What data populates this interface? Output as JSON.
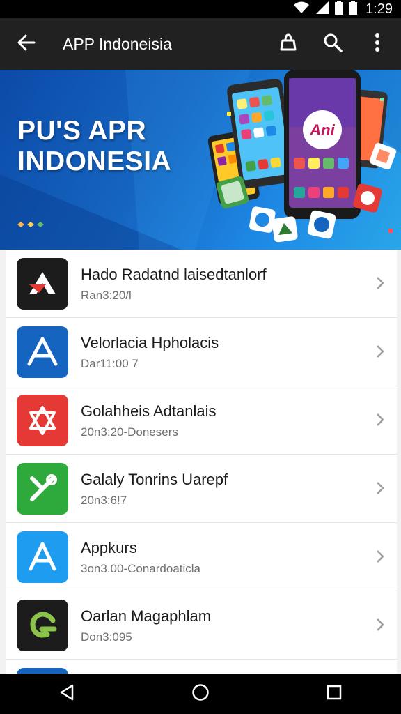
{
  "status_bar": {
    "time": "1:29",
    "icons": [
      "wifi-icon",
      "signal-icon",
      "battery-icon"
    ]
  },
  "toolbar": {
    "title": "APP Indoneisia",
    "icons": [
      "back-arrow-icon",
      "bag-icon",
      "search-icon",
      "more-vert-icon"
    ]
  },
  "banner": {
    "line1": "PU'S APR",
    "line2": "INDONESIA",
    "phone_logo": "Ani"
  },
  "apps": [
    {
      "name": "Hado Radatnd laisedtanlorf",
      "sub": "Ran3:20/l",
      "color": "#1c1c1c",
      "icon": "a-logo-icon"
    },
    {
      "name": "Velorlacia Hpholacis",
      "sub": "Dar11:00 7",
      "color": "#1565c0",
      "icon": "a-logo-icon"
    },
    {
      "name": "Golahheis Adtanlais",
      "sub": "20n3:20-Donesers",
      "color": "#e53935",
      "icon": "star-logo-icon"
    },
    {
      "name": "Galaly Tonrins Uarepf",
      "sub": "20n3:6!7",
      "color": "#2eaa3c",
      "icon": "wrench-logo-icon"
    },
    {
      "name": "Appkurs",
      "sub": "3on3.00-Conardoaticla",
      "color": "#1e9cf0",
      "icon": "appstore-a-icon"
    },
    {
      "name": "Oarlan Magaphlam",
      "sub": "Don3:095",
      "color": "#1c1c1c",
      "icon": "green-swirl-icon"
    }
  ],
  "nav": [
    "back-nav-icon",
    "home-nav-icon",
    "recents-nav-icon"
  ]
}
